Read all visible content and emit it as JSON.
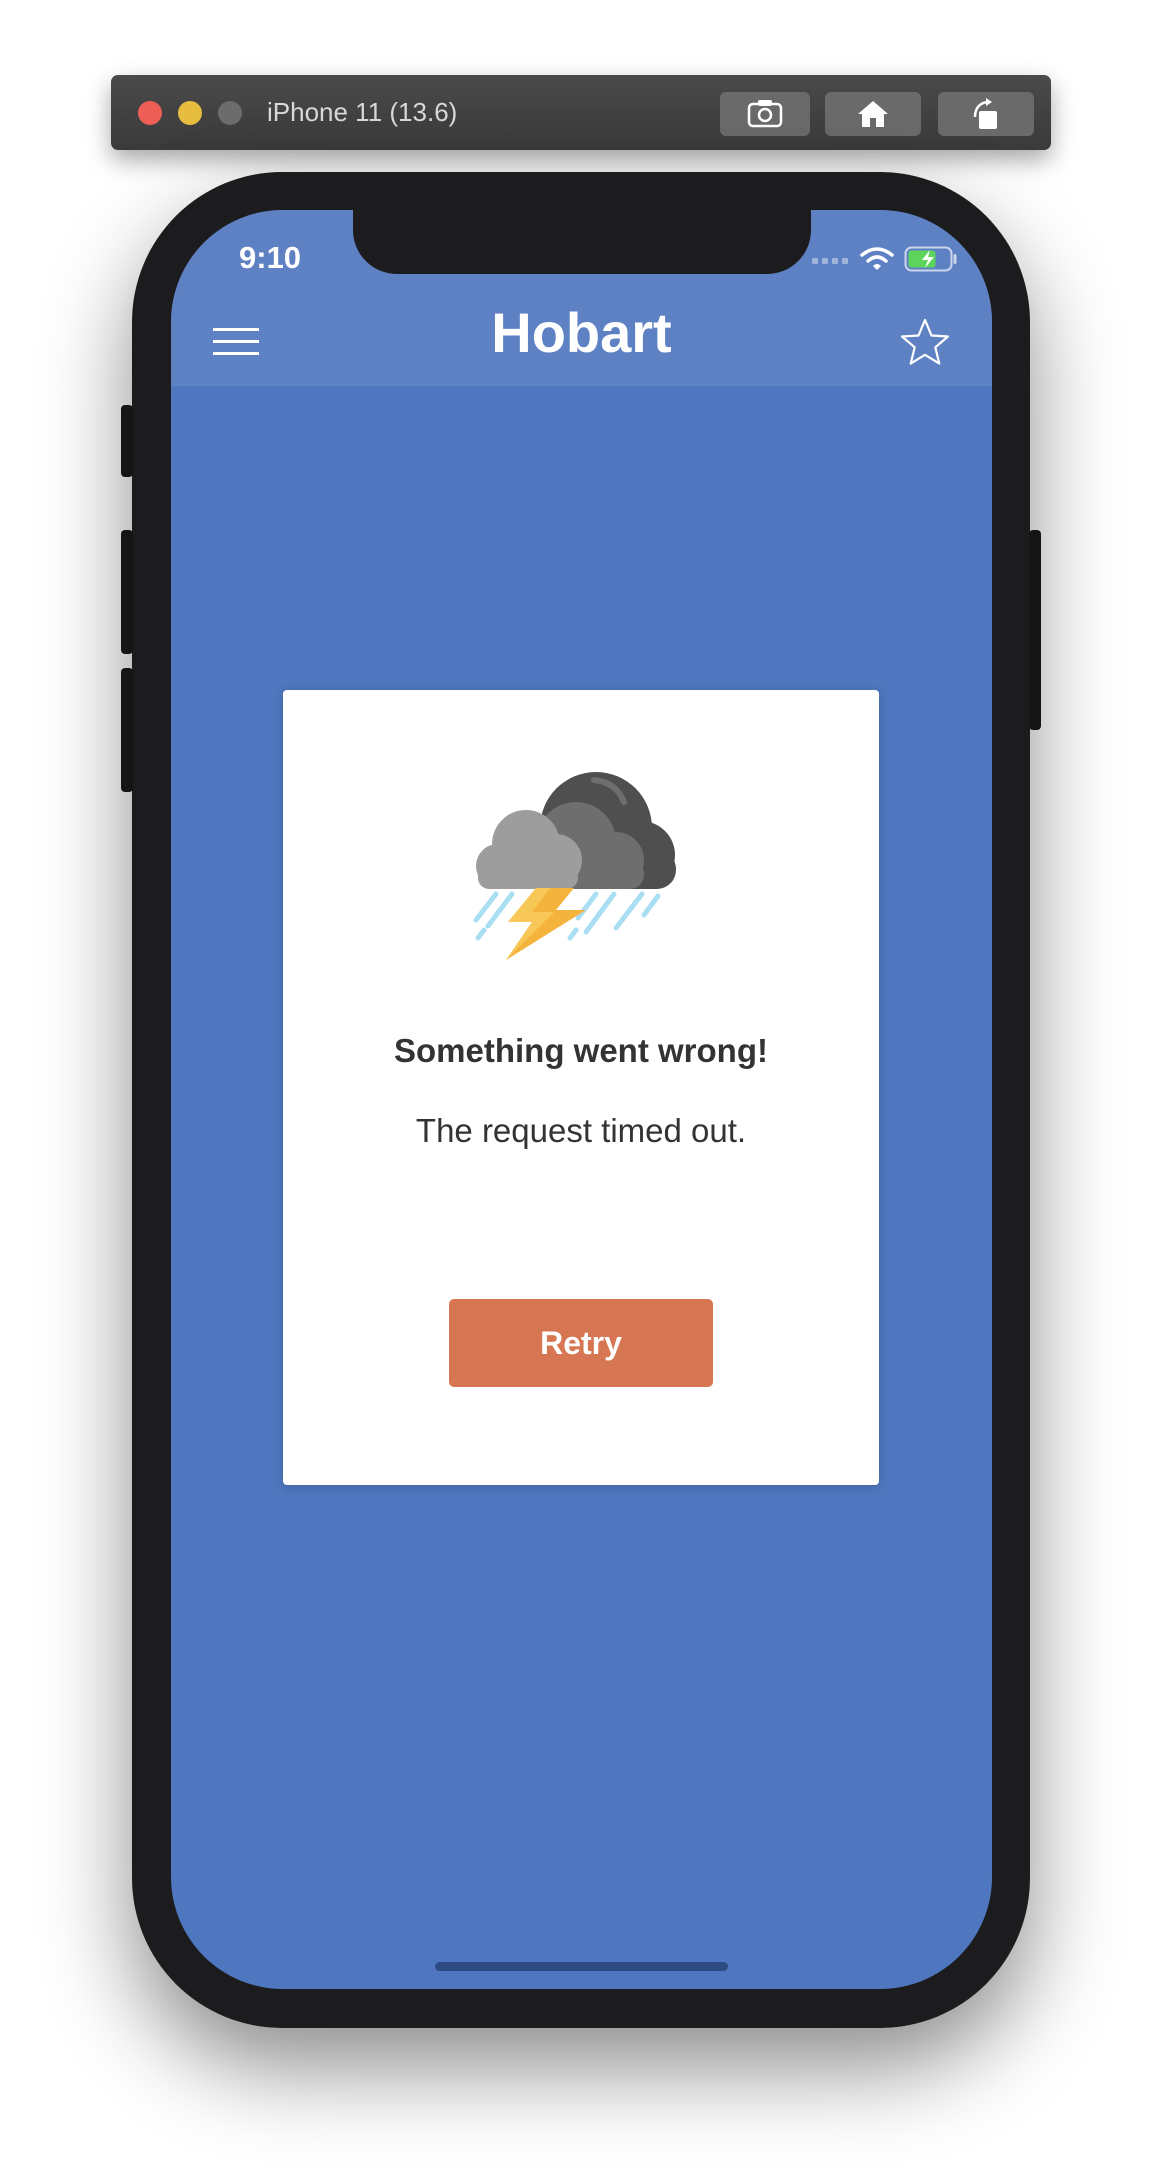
{
  "simulator": {
    "device_title": "iPhone 11 (13.6)",
    "buttons": [
      "screenshot-icon",
      "home-icon",
      "rotate-icon"
    ]
  },
  "status_bar": {
    "time": "9:10",
    "icons": [
      "signal-icon",
      "wifi-icon",
      "battery-charging-icon"
    ]
  },
  "header": {
    "title": "Hobart",
    "menu_icon": "hamburger-menu-icon",
    "favorite_icon": "star-outline-icon"
  },
  "error_card": {
    "icon": "thunderstorm-icon",
    "title": "Something went wrong!",
    "message": "The request timed out.",
    "retry_label": "Retry"
  },
  "colors": {
    "background": "#4f77bf",
    "header": "#5e81c3",
    "retry_button": "#d67652",
    "card": "#ffffff"
  }
}
